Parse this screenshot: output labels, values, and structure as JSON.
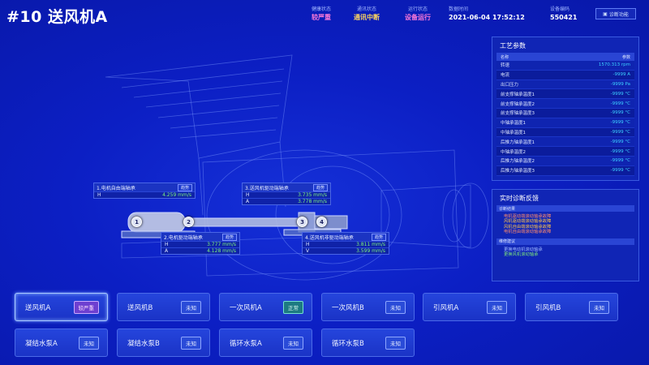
{
  "header": {
    "title": "#10 送风机A",
    "health": {
      "label": "健康状态",
      "value": "较严重",
      "color": "#ff7ad9"
    },
    "comm": {
      "label": "通讯状态",
      "value": "通讯中断",
      "color": "#ffd75e"
    },
    "run": {
      "label": "运行状态",
      "value": "设备运行",
      "color": "#ff7ad9"
    },
    "time": {
      "label": "数据时间",
      "value": "2021-06-04 17:52:12",
      "color": "#ffffff"
    },
    "code": {
      "label": "设备编码",
      "value": "550421",
      "color": "#ffffff"
    },
    "diag_button": "诊断功能"
  },
  "callouts": [
    {
      "title": "1.电机自由端轴承",
      "trend": "趋势",
      "rows": [
        {
          "k": "H",
          "v": "4.259 mm/s"
        }
      ]
    },
    {
      "title": "3.送风机驱动端轴承",
      "trend": "趋势",
      "rows": [
        {
          "k": "H",
          "v": "3.735 mm/s"
        },
        {
          "k": "A",
          "v": "3.778 mm/s"
        }
      ]
    },
    {
      "title": "2.电机驱动端轴承",
      "trend": "趋势",
      "rows": [
        {
          "k": "H",
          "v": "3.777 mm/s"
        },
        {
          "k": "A",
          "v": "4.128 mm/s"
        }
      ]
    },
    {
      "title": "4.送风机非驱动端轴承",
      "trend": "趋势",
      "rows": [
        {
          "k": "H",
          "v": "3.811 mm/s"
        },
        {
          "k": "V",
          "v": "3.599 mm/s"
        }
      ]
    }
  ],
  "markers": [
    "1",
    "2",
    "3",
    "4"
  ],
  "process": {
    "title": "工艺参数",
    "col_name": "名称",
    "col_param": "参数",
    "rows": [
      {
        "name": "转速",
        "value": "1570.313 rpm"
      },
      {
        "name": "电流",
        "value": "-9999 A"
      },
      {
        "name": "出口压力",
        "value": "-9999 Pa"
      },
      {
        "name": "前支撑轴承温度1",
        "value": "-9999 °C"
      },
      {
        "name": "前支撑轴承温度2",
        "value": "-9999 °C"
      },
      {
        "name": "前支撑轴承温度3",
        "value": "-9999 °C"
      },
      {
        "name": "中轴承温度1",
        "value": "-9999 °C"
      },
      {
        "name": "中轴承温度1",
        "value": "-9999 °C"
      },
      {
        "name": "后推力轴承温度1",
        "value": "-9999 °C"
      },
      {
        "name": "中轴承温度2",
        "value": "-9999 °C"
      },
      {
        "name": "后推力轴承温度2",
        "value": "-9999 °C"
      },
      {
        "name": "后推力轴承温度3",
        "value": "-9999 °C"
      }
    ]
  },
  "diagnosis": {
    "title": "实时诊断反馈",
    "result_head": "诊断结果",
    "results": [
      "电机驱动端滚动轴承故障",
      "风机驱动端滚动轴承故障",
      "风机自由端滚动轴承故障",
      "电机自由端滚动轴承故障"
    ],
    "advice_head": "维修建议",
    "advice": [
      "更换电动机滚动轴承",
      "更换风机滚动轴承"
    ]
  },
  "devices": [
    {
      "name": "送风机A",
      "status": "较严重",
      "kind": "severe",
      "active": true
    },
    {
      "name": "送风机B",
      "status": "未知",
      "kind": "unknown",
      "active": false
    },
    {
      "name": "一次风机A",
      "status": "正常",
      "kind": "normal",
      "active": false
    },
    {
      "name": "一次风机B",
      "status": "未知",
      "kind": "unknown",
      "active": false
    },
    {
      "name": "引风机A",
      "status": "未知",
      "kind": "unknown",
      "active": false
    },
    {
      "name": "引风机B",
      "status": "未知",
      "kind": "unknown",
      "active": false
    },
    {
      "name": "凝结水泵A",
      "status": "未知",
      "kind": "unknown",
      "active": false
    },
    {
      "name": "凝结水泵B",
      "status": "未知",
      "kind": "unknown",
      "active": false
    },
    {
      "name": "循环水泵A",
      "status": "未知",
      "kind": "unknown",
      "active": false
    },
    {
      "name": "循环水泵B",
      "status": "未知",
      "kind": "unknown",
      "active": false
    }
  ]
}
